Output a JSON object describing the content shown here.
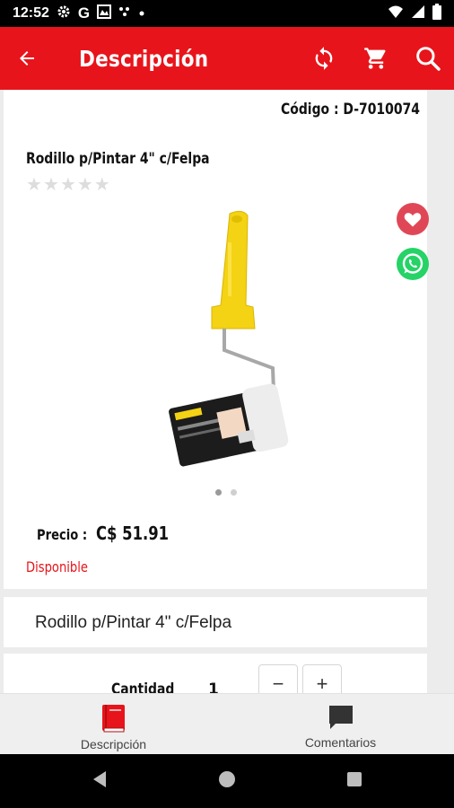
{
  "status_bar": {
    "time": "12:52",
    "icons_left": [
      "gear-icon",
      "google-g-icon",
      "gallery-icon",
      "dots-icon",
      "small-dot-icon"
    ],
    "icons_right": [
      "wifi-icon",
      "signal-icon",
      "battery-icon"
    ]
  },
  "app_bar": {
    "title": "Descripción",
    "color": "#e8141b",
    "actions": [
      "refresh-icon",
      "cart-icon",
      "search-icon"
    ]
  },
  "product": {
    "code_text": "Código : D-7010074",
    "title": "Rodillo p/Pintar 4\" c/Felpa",
    "rating": 0,
    "rating_max": 5,
    "image_count": 2,
    "current_image": 1,
    "price_label": "Precio :",
    "price_value": "C$ 51.91",
    "availability": "Disponible",
    "description": "Rodillo p/Pintar 4\" c/Felpa"
  },
  "quantity": {
    "label": "Cantidad",
    "value": "1",
    "minus": "−",
    "plus": "+"
  },
  "bottom_nav": {
    "items": [
      {
        "label": "Descripción",
        "icon": "book-icon"
      },
      {
        "label": "Comentarios",
        "icon": "comment-icon"
      }
    ]
  },
  "colors": {
    "accent": "#e8141b",
    "favorite": "#e04756",
    "whatsapp": "#25d366"
  }
}
